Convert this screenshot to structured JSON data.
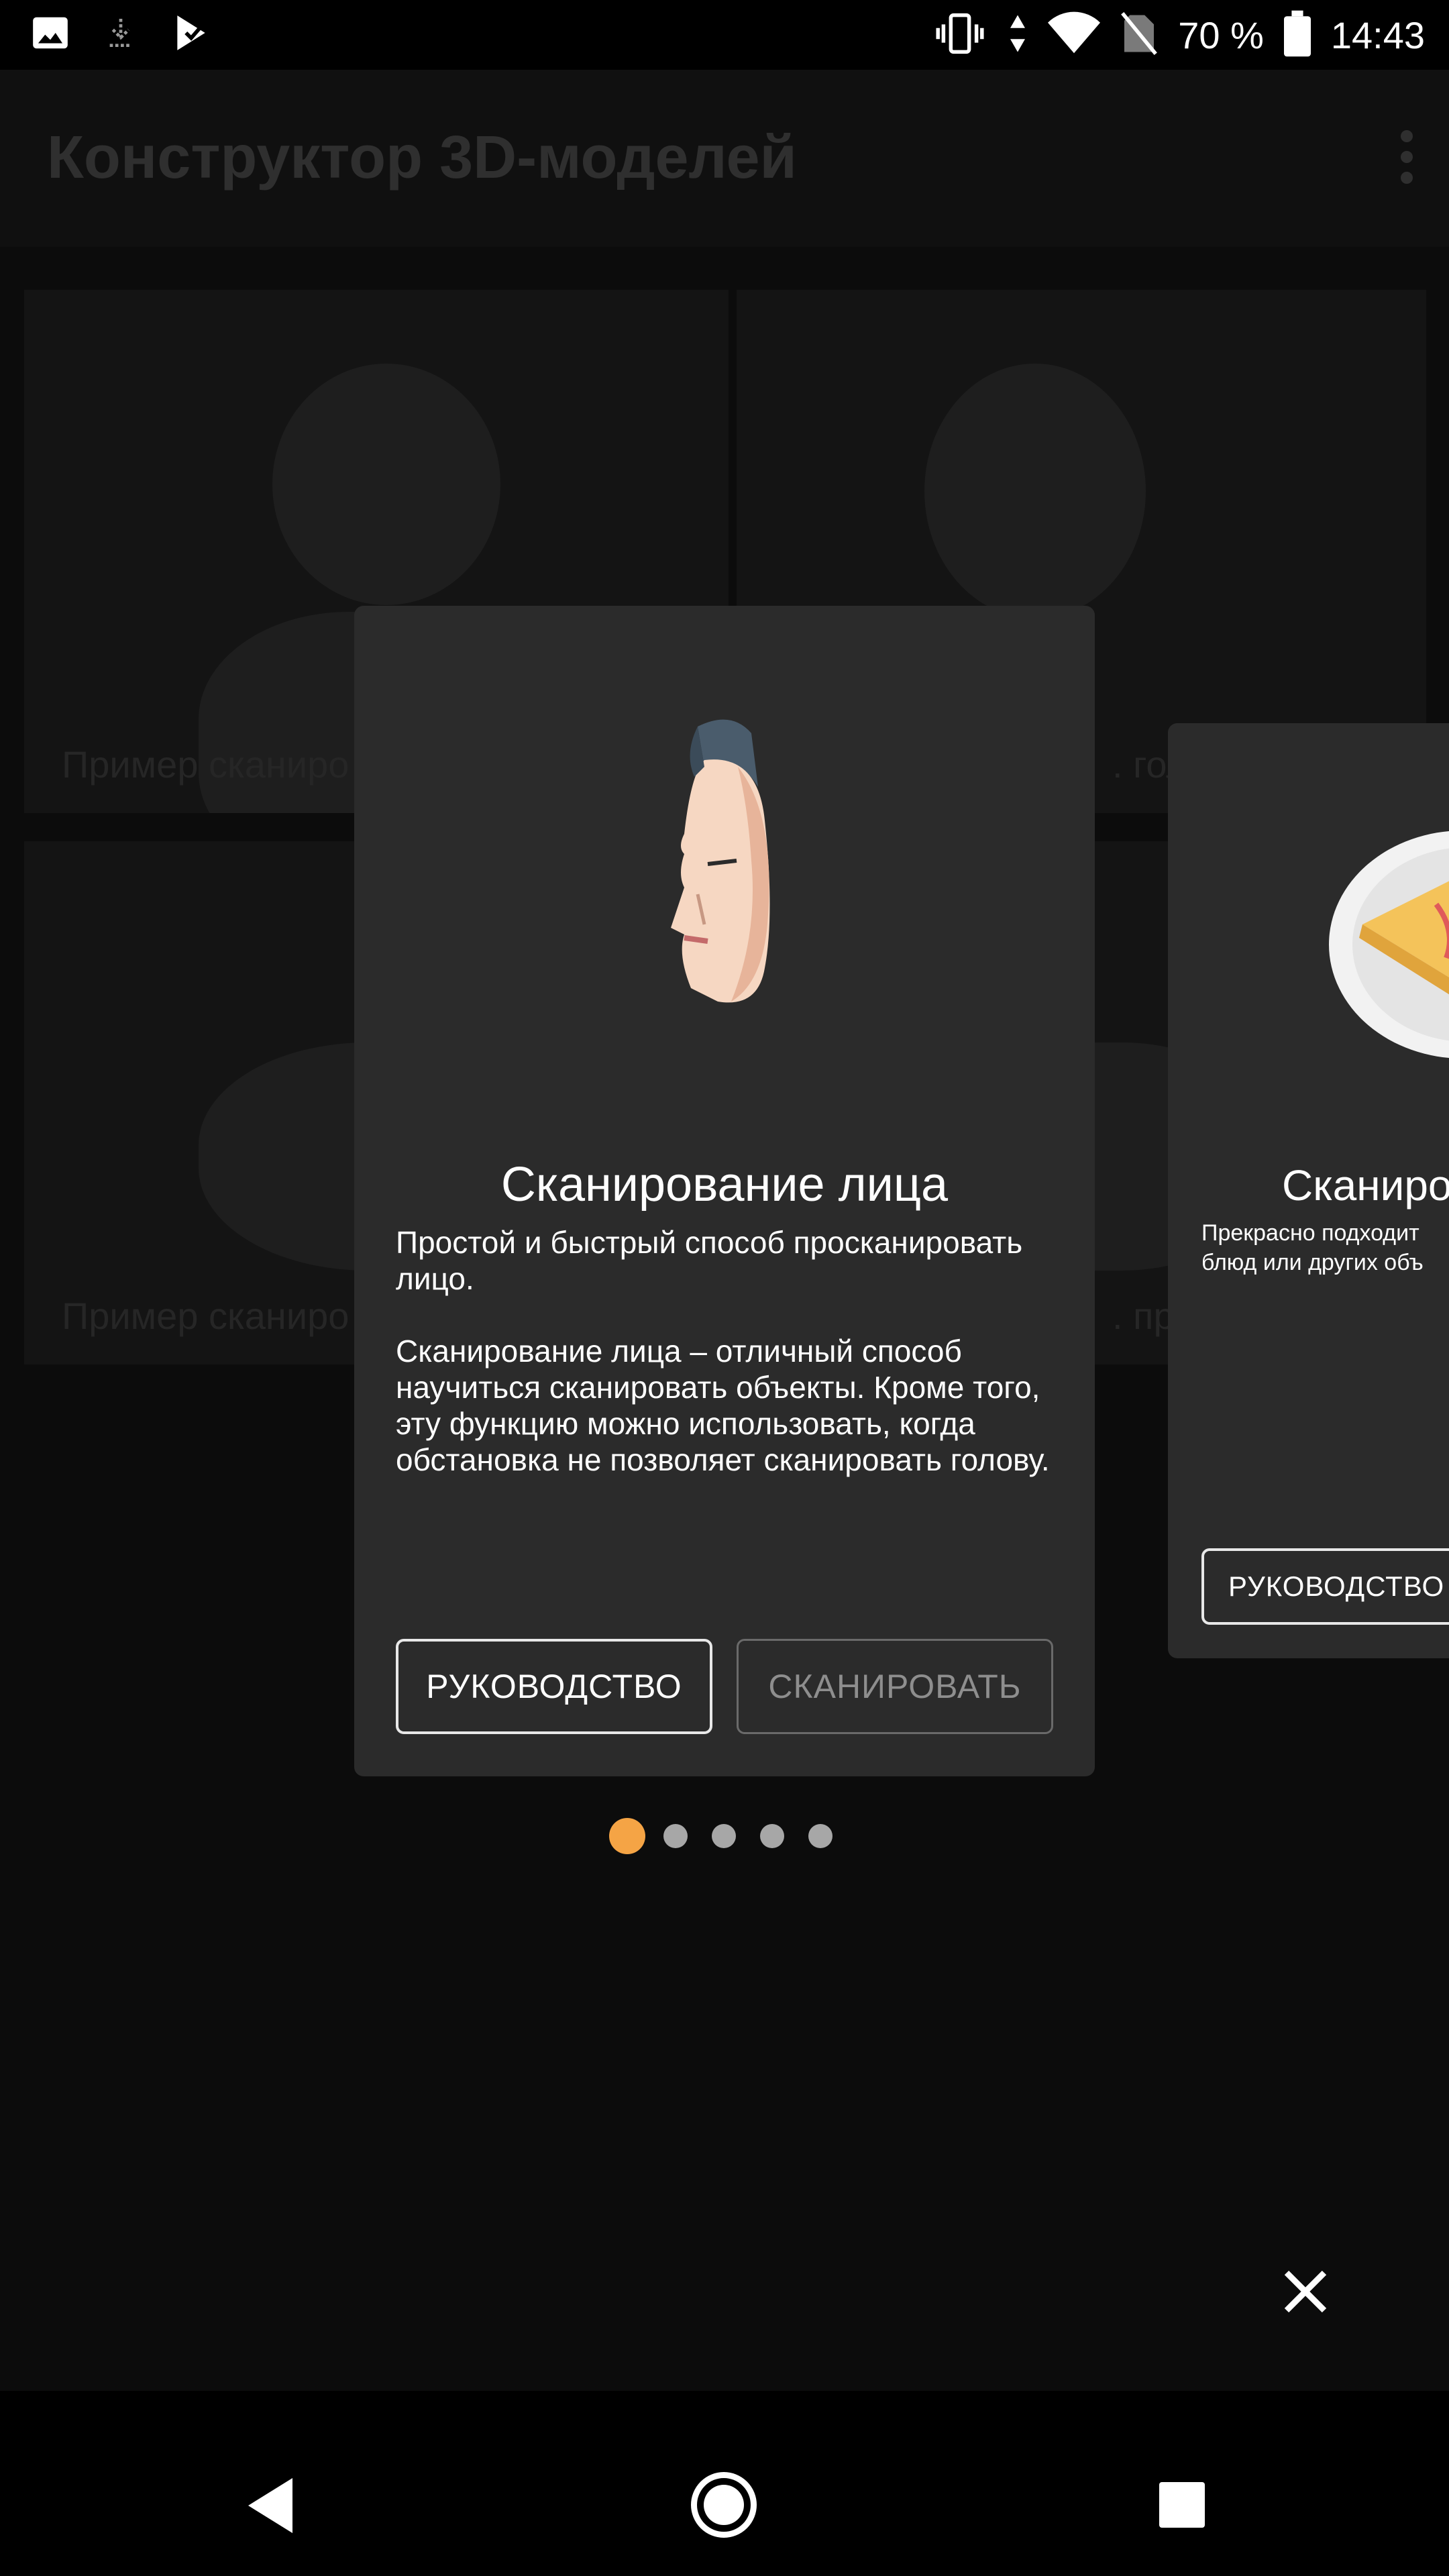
{
  "status_bar": {
    "battery_percent": "70 %",
    "time": "14:43",
    "icons_left": [
      "image-icon",
      "download-icon",
      "play-store-icon"
    ],
    "icons_right": [
      "vibrate-icon",
      "data-transfer-icon",
      "wifi-icon",
      "no-sim-icon",
      "battery-icon"
    ]
  },
  "app_bar": {
    "title": "Конструктор 3D-моделей",
    "menu_icon": "more-vert-icon"
  },
  "background_cards": [
    {
      "label": "Пример сканиро"
    },
    {
      "label": ". гол"
    },
    {
      "label": "Пример сканиро"
    },
    {
      "label": ". пре"
    }
  ],
  "carousel": {
    "active_index": 0,
    "page_count": 5,
    "cards": [
      {
        "title": "Сканирование лица",
        "body": [
          "Простой и быстрый способ просканировать лицо.",
          "Сканирование лица – отличный способ научиться сканировать объекты. Кроме того, эту функцию можно использовать, когда обстановка не позволяет сканировать голову."
        ],
        "guide_label": "РУКОВОДСТВО",
        "scan_label": "СКАНИРОВАТЬ",
        "illustration": "face-profile-icon"
      },
      {
        "title": "Сканиро",
        "body_line1": "Прекрасно подходит",
        "body_line2": "блюд или других объ",
        "guide_label": "РУКОВОДСТВО",
        "illustration": "food-plate-icon"
      }
    ]
  },
  "close_icon": "close-icon",
  "nav_bar": {
    "back": "back-icon",
    "home": "home-icon",
    "recents": "recents-icon"
  },
  "colors": {
    "accent_dot": "#f5a445",
    "card_background": "#2b2b2b",
    "inactive_dot": "#a7a7a7"
  }
}
